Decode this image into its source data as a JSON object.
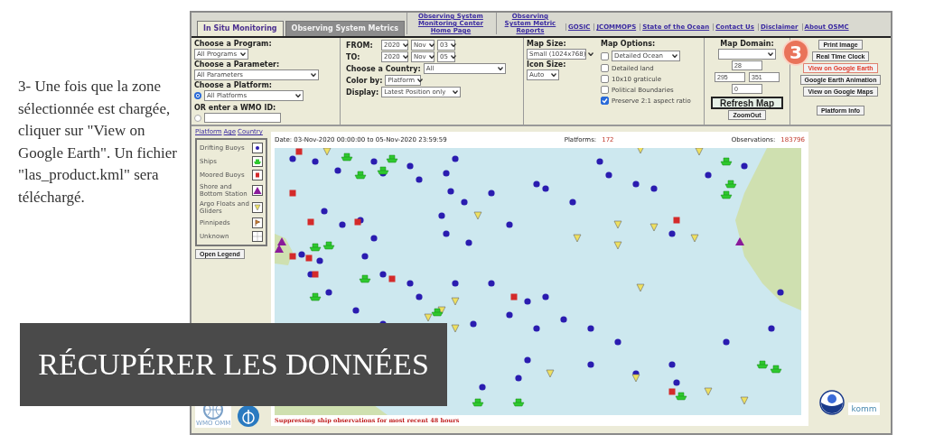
{
  "intro": {
    "text": "3- Une fois que la zone sélectionnée est chargée, cliquer sur \"View on Google Earth\". Un fichier \"las_product.kml\" sera téléchargé."
  },
  "banner": {
    "title": "RÉCUPÉRER LES DONNÉES"
  },
  "app": {
    "nav": {
      "tabs": [
        {
          "label": "In Situ Monitoring",
          "selected": true
        },
        {
          "label": "Observing System Metrics",
          "selected": false
        }
      ],
      "links": [
        {
          "label": "Observing System Monitoring Center Home Page",
          "kind": "block"
        },
        {
          "label": "Observing System Metric Reports",
          "kind": "block"
        },
        {
          "label": "GOSIC",
          "kind": "inline"
        },
        {
          "label": "JCOMMOPS",
          "kind": "inline"
        },
        {
          "label": "State of the Ocean",
          "kind": "inline"
        },
        {
          "label": "Contact Us",
          "kind": "inline"
        },
        {
          "label": "Disclaimer",
          "kind": "inline"
        },
        {
          "label": "About OSMC",
          "kind": "inline"
        }
      ]
    },
    "controls": {
      "program": {
        "label": "Choose a Program:",
        "value": "All Programs"
      },
      "parameter": {
        "label": "Choose a Parameter:",
        "value": "All Parameters"
      },
      "platform": {
        "label": "Choose a Platform:",
        "value": "All Platforms",
        "selected": true
      },
      "wmo": {
        "label": "OR enter a WMO ID:",
        "selected": false
      },
      "dates": [
        {
          "label": "FROM:",
          "year": "2020",
          "month": "Nov",
          "day": "03"
        },
        {
          "label": "TO:",
          "year": "2020",
          "month": "Nov",
          "day": "05"
        }
      ],
      "country": {
        "label": "Choose a Country:",
        "value": "All"
      },
      "color_by": {
        "label": "Color by:",
        "value": "Platform"
      },
      "display": {
        "label": "Display:",
        "value": "Latest Position only"
      },
      "map_size": {
        "label": "Map Size:",
        "value": "Small (1024x768)"
      },
      "icon_size": {
        "label": "Icon Size:",
        "value": "Auto"
      },
      "map_options": {
        "label": "Map Options:",
        "items": [
          {
            "label": "Detailed Ocean",
            "checked": false,
            "kind": "dropdown"
          },
          {
            "label": "Detailed land",
            "checked": false,
            "kind": "checkbox"
          },
          {
            "label": "10x10 graticule",
            "checked": false,
            "kind": "checkbox"
          },
          {
            "label": "Political Boundaries",
            "checked": false,
            "kind": "checkbox"
          },
          {
            "label": "Preserve 2:1 aspect ratio",
            "checked": true,
            "kind": "checkbox"
          }
        ]
      },
      "map_domain": {
        "label": "Map Domain:",
        "north": "28",
        "west": "295",
        "east": "351",
        "south": "0"
      },
      "refresh": "Refresh Map",
      "zoom_out": "ZoomOut",
      "buttons": [
        {
          "label": "Print Image",
          "highlighted": false
        },
        {
          "label": "Real Time Clock",
          "highlighted": false
        },
        {
          "label": "View on Google Earth",
          "highlighted": true
        },
        {
          "label": "Google Earth Animation",
          "highlighted": false
        },
        {
          "label": "View on Google Maps",
          "highlighted": false
        }
      ],
      "info_button": "Platform Info",
      "step_badge": "3"
    },
    "sidebar": {
      "links": [
        "Platform",
        "Age",
        "Country"
      ],
      "legend": [
        {
          "label": "Drifting Buoys",
          "kind": "dot"
        },
        {
          "label": "Ships",
          "kind": "ship"
        },
        {
          "label": "Moored Buoys",
          "kind": "square"
        },
        {
          "label": "Shore and Bottom Station",
          "kind": "triangle-up"
        },
        {
          "label": "Argo Floats and Gliders",
          "kind": "triangle-down"
        },
        {
          "label": "Pinnipeds",
          "kind": "flag"
        },
        {
          "label": "Unknown",
          "kind": "grid"
        }
      ],
      "open_legend": "Open Legend"
    },
    "map": {
      "date": "Date: 03-Nov-2020 00:00:00 to 05-Nov-2020 23:59:59",
      "platforms_label": "Platforms:",
      "platforms_value": "172",
      "observations_label": "Observations:",
      "observations_value": "183796",
      "notice": "Suppressing ship observations for most recent 48 hours"
    },
    "footer": {
      "wmo_caption": "WMO OMM",
      "komm_logo": "komm"
    }
  }
}
